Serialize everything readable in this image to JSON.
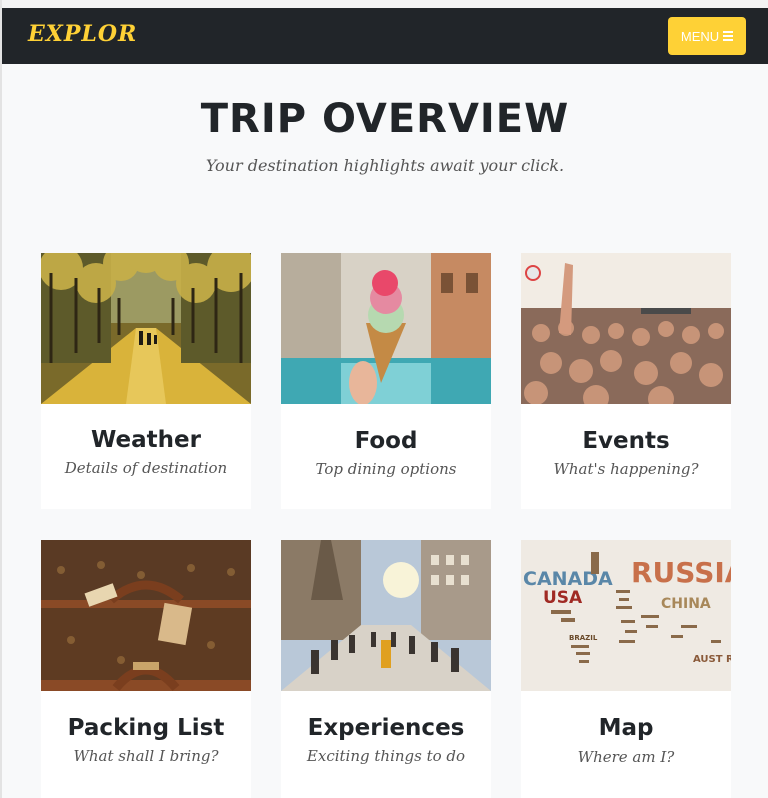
{
  "navbar": {
    "brand": "EXPLOR",
    "menu_label": "MENU",
    "menu_icon": "hamburger-icon",
    "brand_color": "#fed136"
  },
  "header": {
    "title": "TRIP OVERVIEW",
    "subtitle": "Your destination highlights await your click."
  },
  "cards": [
    {
      "title": "Weather",
      "subtitle": "Details of destination",
      "image": "autumn-tree-avenue-photo"
    },
    {
      "title": "Food",
      "subtitle": "Top dining options",
      "image": "gelato-cone-fountain-photo"
    },
    {
      "title": "Events",
      "subtitle": "What's happening?",
      "image": "concert-crowd-photo"
    },
    {
      "title": "Packing List",
      "subtitle": "What shall I bring?",
      "image": "vintage-suitcases-photo"
    },
    {
      "title": "Experiences",
      "subtitle": "Exciting things to do",
      "image": "city-street-crowd-photo"
    },
    {
      "title": "Map",
      "subtitle": "Where am I?",
      "image": "word-cloud-world-map",
      "map_words": [
        "CANADA",
        "USA",
        "RUSSIA",
        "CHINA",
        "AUST RALIA",
        "BRAZIL"
      ]
    }
  ]
}
